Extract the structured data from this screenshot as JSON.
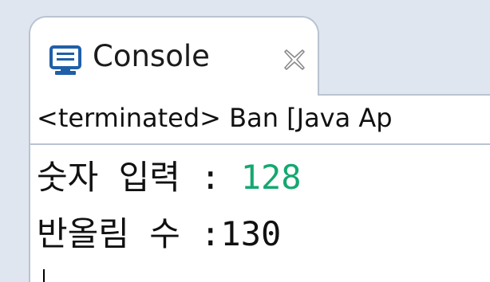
{
  "tab": {
    "icon": "console-monitor-icon",
    "title": "Console",
    "close_icon": "close-x-icon"
  },
  "status": {
    "text": "<terminated> Ban [Java Ap"
  },
  "console": {
    "line1_prompt": "숫자 입력 : ",
    "line1_input": "128",
    "line2_text": "반올림 수 :130"
  },
  "colors": {
    "input_text": "#14a870",
    "tab_border": "#b9c4d2",
    "icon_blue": "#1f5fa8"
  }
}
